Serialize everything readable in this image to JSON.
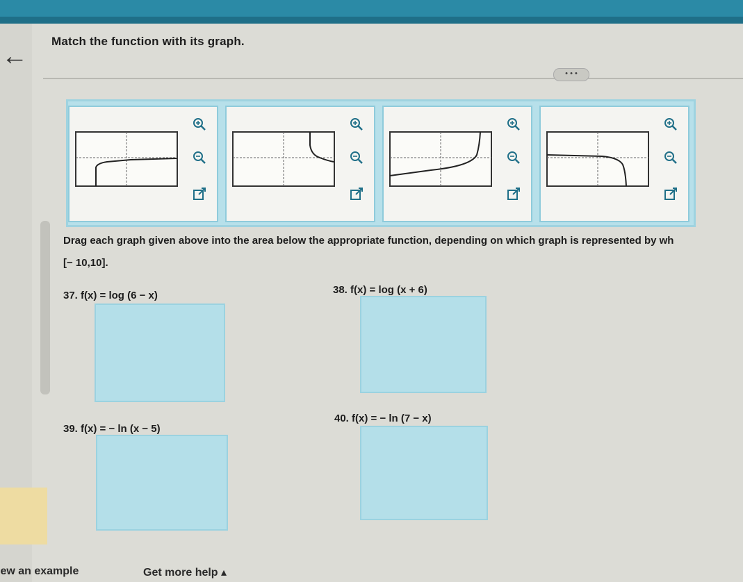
{
  "header": {
    "back_icon": "back-arrow-icon",
    "title": "Match the function with its graph.",
    "more_label": "• • •"
  },
  "graphs": [
    {
      "id": "graph-a",
      "icons": [
        "zoom-in-icon",
        "zoom-out-icon",
        "expand-icon"
      ]
    },
    {
      "id": "graph-b",
      "icons": [
        "zoom-in-icon",
        "zoom-out-icon",
        "expand-icon"
      ]
    },
    {
      "id": "graph-c",
      "icons": [
        "zoom-in-icon",
        "zoom-out-icon",
        "expand-icon"
      ]
    },
    {
      "id": "graph-d",
      "icons": [
        "zoom-in-icon",
        "zoom-out-icon",
        "expand-icon"
      ]
    }
  ],
  "instructions": {
    "text": "Drag each graph given above into the area below the appropriate function, depending on which graph is represented by wh",
    "interval": "[− 10,10]."
  },
  "problems": [
    {
      "label": "37. f(x) = log (6 − x)"
    },
    {
      "label": "38. f(x) = log (x + 6)"
    },
    {
      "label": "39. f(x) = − ln (x − 5)"
    },
    {
      "label": "40. f(x) = − ln (7 − x)"
    }
  ],
  "footer": {
    "view_example": "iew an example",
    "get_help": "Get more help ▴"
  },
  "colors": {
    "accent": "#2b8aa6",
    "tray": "#b7e0ea",
    "drop_zone": "#b4dfe9"
  }
}
